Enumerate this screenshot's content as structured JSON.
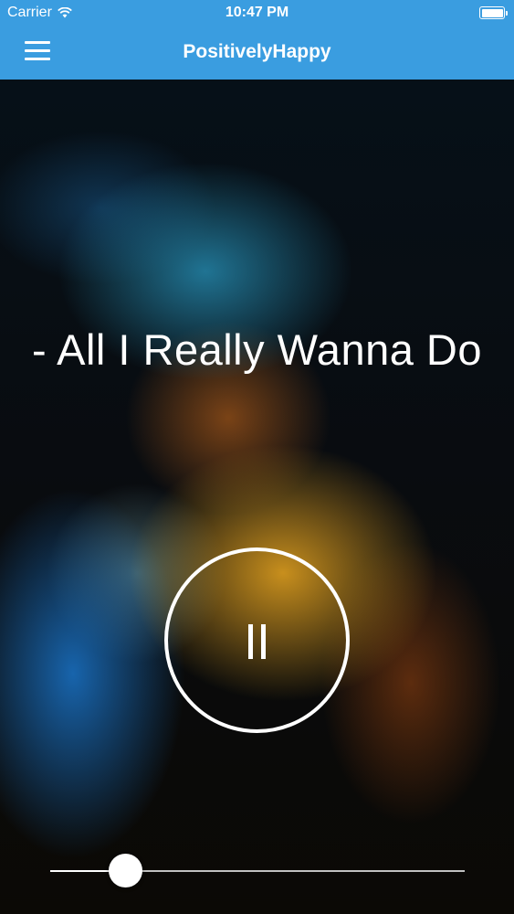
{
  "status_bar": {
    "carrier": "Carrier",
    "time": "10:47 PM",
    "wifi_icon": "wifi-icon",
    "battery_icon": "battery-icon"
  },
  "nav_bar": {
    "menu_icon": "hamburger-menu-icon",
    "title": "PositivelyHappy",
    "color": "#3a9de0"
  },
  "player": {
    "song_title": "- All I Really Wanna Do",
    "control_icon": "pause-icon",
    "progress_fraction": 0.18
  }
}
